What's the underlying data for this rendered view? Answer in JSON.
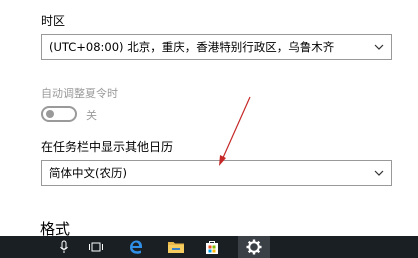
{
  "settings": {
    "timezone": {
      "label": "时区",
      "value": "(UTC+08:00) 北京，重庆，香港特别行政区，乌鲁木齐"
    },
    "dst": {
      "label": "自动调整夏令时",
      "state": "关"
    },
    "calendar": {
      "label": "在任务栏中显示其他日历",
      "value": "简体中文(农历)"
    },
    "format": {
      "label": "格式"
    }
  },
  "colors": {
    "annotation_arrow": "#c62828",
    "taskbar_bg": "#1a1f24",
    "disabled_text": "#9a9a9a"
  },
  "taskbar": {
    "icons": [
      "microphone-icon",
      "task-view-icon",
      "edge-icon",
      "file-explorer-icon",
      "store-icon",
      "settings-gear-icon"
    ]
  }
}
